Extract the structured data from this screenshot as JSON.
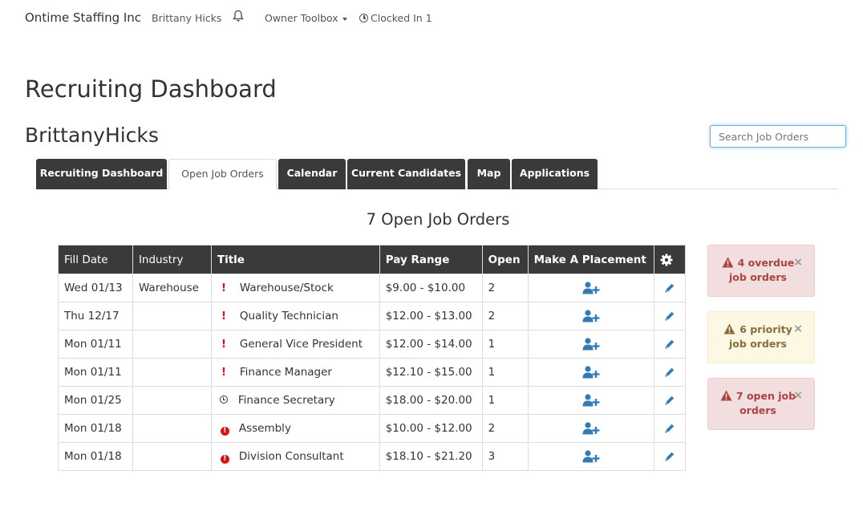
{
  "navbar": {
    "brand": "Ontime Staffing Inc",
    "user": "Brittany Hicks",
    "toolbox": "Owner Toolbox",
    "clocked": "Clocked In 1"
  },
  "page_title": "Recruiting Dashboard",
  "user_title": "BrittanyHicks",
  "search": {
    "placeholder": "Search Job Orders"
  },
  "tabs": [
    {
      "label": "Recruiting Dashboard"
    },
    {
      "label": "Open Job Orders"
    },
    {
      "label": "Calendar"
    },
    {
      "label": "Current Candidates"
    },
    {
      "label": "Map"
    },
    {
      "label": "Applications"
    }
  ],
  "orders_heading": "7 Open Job Orders",
  "table": {
    "headers": [
      "Fill Date",
      "Industry",
      "Title",
      "Pay Range",
      "Open",
      "Make A Placement"
    ],
    "settings_icon": "gear-icon",
    "rows": [
      {
        "fill_date": "Wed 01/13",
        "industry": "Warehouse",
        "flag": "exclamation-icon",
        "title": "Warehouse/Stock",
        "pay": "$9.00 - $10.00",
        "open": "2"
      },
      {
        "fill_date": "Thu 12/17",
        "industry": "",
        "flag": "exclamation-icon",
        "title": "Quality Technician",
        "pay": "$12.00 - $13.00",
        "open": "2"
      },
      {
        "fill_date": "Mon 01/11",
        "industry": "",
        "flag": "exclamation-icon",
        "title": "General Vice President",
        "pay": "$12.00 - $14.00",
        "open": "1"
      },
      {
        "fill_date": "Mon 01/11",
        "industry": "",
        "flag": "exclamation-icon",
        "title": "Finance Manager",
        "pay": "$12.10 - $15.00",
        "open": "1"
      },
      {
        "fill_date": "Mon 01/25",
        "industry": "",
        "flag": "clock-icon",
        "title": "Finance Secretary",
        "pay": "$18.00 - $20.00",
        "open": "1"
      },
      {
        "fill_date": "Mon 01/18",
        "industry": "",
        "flag": "exclamation-circle-icon",
        "title": "Assembly",
        "pay": "$10.00 - $12.00",
        "open": "2"
      },
      {
        "fill_date": "Mon 01/18",
        "industry": "",
        "flag": "exclamation-circle-icon",
        "title": "Division Consultant",
        "pay": "$18.10 - $21.20",
        "open": "3"
      }
    ]
  },
  "alerts": [
    {
      "type": "danger",
      "line1": "4 overdue",
      "line2": "job orders"
    },
    {
      "type": "warning",
      "line1": "6 priority",
      "line2": "job orders"
    },
    {
      "type": "danger",
      "line1": "7 open job",
      "line2": "orders"
    }
  ],
  "colors": {
    "dark_header": "#3a3a3a",
    "accent_blue": "#337ab7",
    "flag_red": "#d9130f",
    "danger_text": "#a94442",
    "warning_text": "#8a6d3b"
  }
}
